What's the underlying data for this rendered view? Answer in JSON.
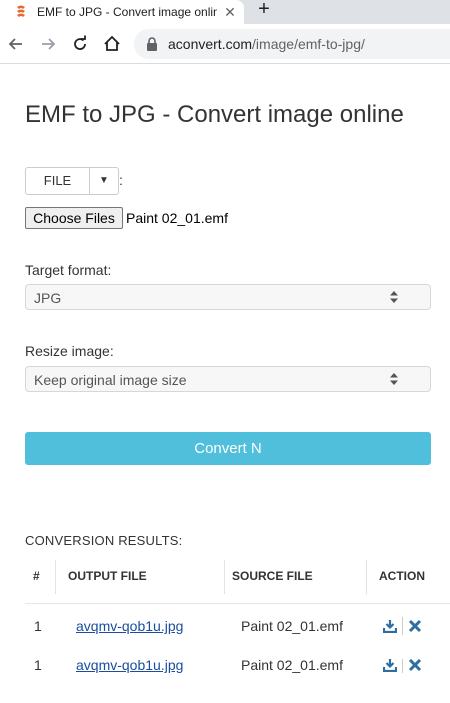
{
  "browser": {
    "tab_title": "EMF to JPG - Convert image online",
    "tab_close": "✕",
    "new_tab": "+",
    "url_domain": "aconvert.com",
    "url_path": "/image/emf-to-jpg/"
  },
  "page": {
    "title": "EMF to JPG - Convert image online",
    "file_source_label": "FILE",
    "file_colon": ":",
    "choose_files_label": "Choose Files",
    "chosen_file": "Paint 02_01.emf",
    "target_format_label": "Target format:",
    "target_format_value": "JPG",
    "resize_label": "Resize image:",
    "resize_value": "Keep original image size",
    "convert_label": "Convert N"
  },
  "results": {
    "title": "CONVERSION RESULTS:",
    "headers": [
      "#",
      "OUTPUT FILE",
      "SOURCE FILE",
      "ACTION"
    ],
    "rows": [
      {
        "index": "1",
        "output": "avqmv-qob1u.jpg",
        "source": "Paint 02_01.emf"
      },
      {
        "index": "1",
        "output": "avqmv-qob1u.jpg",
        "source": "Paint 02_01.emf"
      }
    ]
  },
  "colors": {
    "accent": "#4fbfdb",
    "link": "#1a4da0",
    "action_icon": "#2e6da4",
    "favicon": "#e8682e"
  },
  "icons": [
    "favicon-icon",
    "close-icon",
    "plus-icon",
    "back-icon",
    "forward-icon",
    "reload-icon",
    "home-icon",
    "lock-icon",
    "caret-down-icon",
    "select-arrows-icon",
    "download-icon",
    "delete-icon"
  ]
}
